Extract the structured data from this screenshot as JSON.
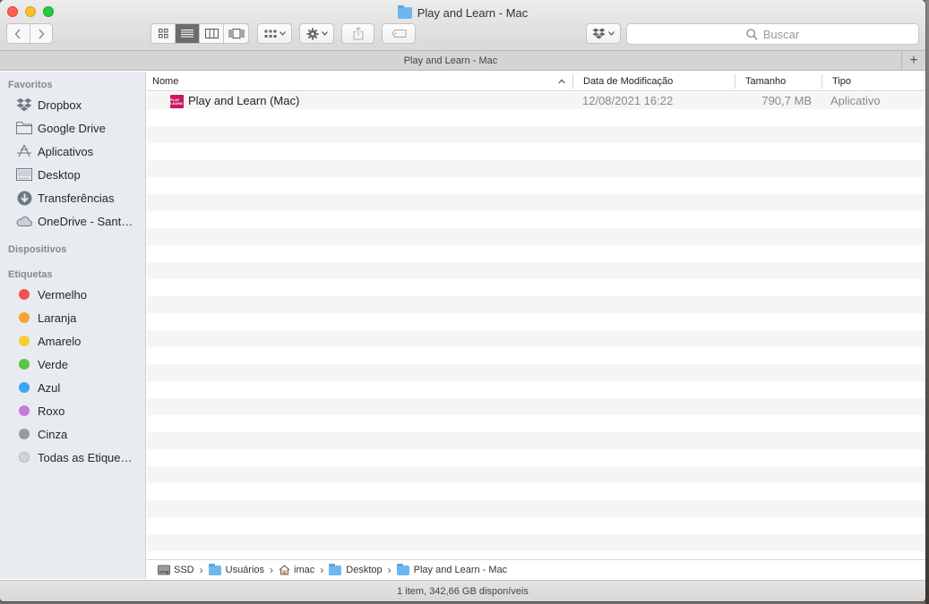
{
  "window": {
    "title": "Play and Learn - Mac"
  },
  "toolbar": {
    "back_icon": "chevron-left-icon",
    "forward_icon": "chevron-right-icon",
    "view_modes": [
      "icon-view",
      "list-view",
      "column-view",
      "gallery-view"
    ],
    "active_view": "list-view",
    "search_placeholder": "Buscar"
  },
  "tabbar": {
    "title": "Play and Learn - Mac",
    "add_symbol": "+"
  },
  "sidebar": {
    "favorites_header": "Favoritos",
    "favorites": [
      {
        "label": "Dropbox",
        "icon": "dropbox-icon"
      },
      {
        "label": "Google Drive",
        "icon": "folder-icon"
      },
      {
        "label": "Aplicativos",
        "icon": "applications-icon"
      },
      {
        "label": "Desktop",
        "icon": "desktop-icon"
      },
      {
        "label": "Transferências",
        "icon": "download-icon"
      },
      {
        "label": "OneDrive - Sant…",
        "icon": "cloud-icon"
      }
    ],
    "devices_header": "Dispositivos",
    "tags_header": "Etiquetas",
    "tags": [
      {
        "label": "Vermelho",
        "color": "#f2514f"
      },
      {
        "label": "Laranja",
        "color": "#f8a234"
      },
      {
        "label": "Amarelo",
        "color": "#f7cc31"
      },
      {
        "label": "Verde",
        "color": "#5ac34b"
      },
      {
        "label": "Azul",
        "color": "#3ba5f5"
      },
      {
        "label": "Roxo",
        "color": "#c77bd8"
      },
      {
        "label": "Cinza",
        "color": "#9a9a9a"
      },
      {
        "label": "Todas as Etique…",
        "color": "#d4d4d4"
      }
    ]
  },
  "columns": {
    "name": "Nome",
    "modified": "Data de Modificação",
    "size": "Tamanho",
    "kind": "Tipo"
  },
  "files": [
    {
      "name": "Play and Learn (Mac)",
      "modified": "12/08/2021 16:22",
      "size": "790,7 MB",
      "kind": "Aplicativo",
      "icon_text": "PLAY LEARN",
      "icon_color": "#c8175d"
    }
  ],
  "pathbar": [
    {
      "label": "SSD",
      "icon": "disk-icon"
    },
    {
      "label": "Usuários",
      "icon": "folder-icon"
    },
    {
      "label": "imac",
      "icon": "home-icon"
    },
    {
      "label": "Desktop",
      "icon": "folder-icon"
    },
    {
      "label": "Play and Learn - Mac",
      "icon": "folder-icon"
    }
  ],
  "status": {
    "text": "1 item, 342,66 GB disponíveis"
  }
}
